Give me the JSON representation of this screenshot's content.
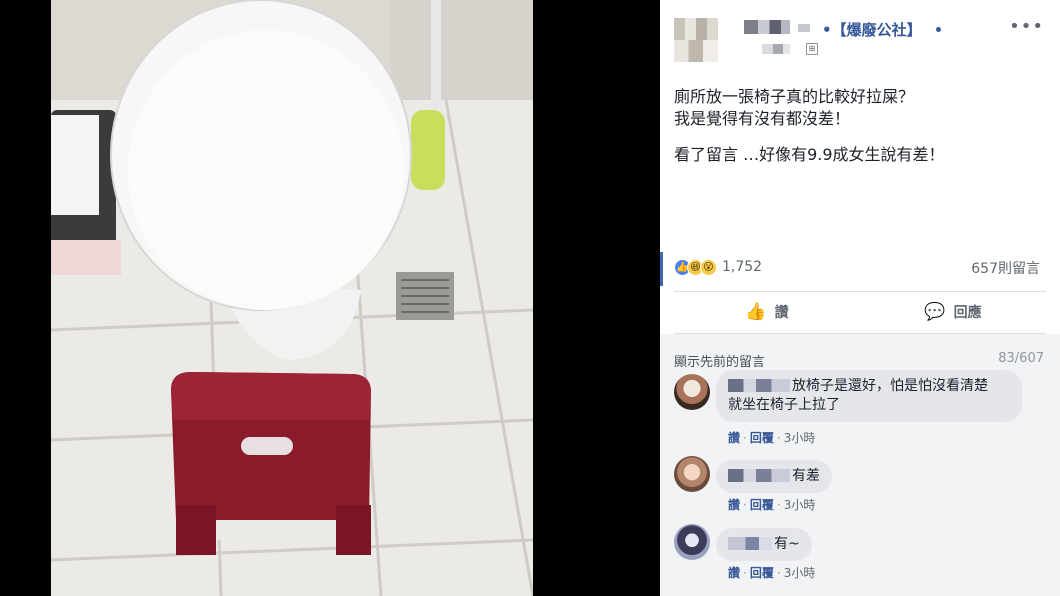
{
  "post": {
    "group_name": "•【爆廢公社】",
    "text_lines": [
      "廁所放一張椅子真的比較好拉屎？",
      "我是覺得有沒有都沒差！"
    ],
    "text_line3": "看了留言 …好像有9.9成女生說有差！",
    "reaction_count": "1,752",
    "comment_count": "657則留言"
  },
  "actions": {
    "like": "讚",
    "comment": "回應"
  },
  "comments_section": {
    "prev_link": "顯示先前的留言",
    "counter": "83/607"
  },
  "comments": [
    {
      "text_line1": "放椅子是還好，怕是怕沒看清楚",
      "text_line2": "就坐在椅子上拉了",
      "like": "讚",
      "reply": "回覆",
      "time": "3小時"
    },
    {
      "text_line1": "有差",
      "like": "讚",
      "reply": "回覆",
      "time": "3小時"
    },
    {
      "text_line1": "有~",
      "like": "讚",
      "reply": "回覆",
      "time": "3小時"
    }
  ],
  "icons": {
    "more": "•••",
    "like_icon": "👍",
    "comment_icon": "💬",
    "react_like": "👍",
    "react_haha": "😆",
    "react_wow": "😮"
  },
  "colors": {
    "facebook_blue": "#365899",
    "comment_bg": "#f2f3f5",
    "bubble": "#e4e6eb",
    "stool_red": "#8a1b2a"
  }
}
